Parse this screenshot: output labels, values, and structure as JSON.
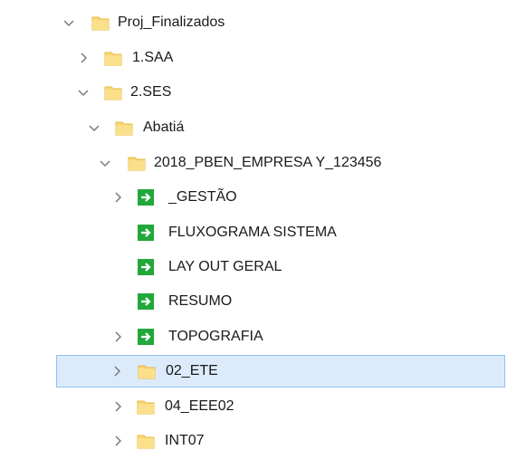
{
  "tree": {
    "items": [
      {
        "label": "Proj_Finalizados",
        "type": "folder",
        "expander": "expanded"
      },
      {
        "label": "1.SAA",
        "type": "folder",
        "expander": "collapsed"
      },
      {
        "label": "2.SES",
        "type": "folder",
        "expander": "expanded"
      },
      {
        "label": "Abatiá",
        "type": "folder",
        "expander": "expanded"
      },
      {
        "label": "2018_PBEN_EMPRESA Y_123456",
        "type": "folder",
        "expander": "expanded"
      },
      {
        "label": "_GESTÃO",
        "type": "shortcut",
        "expander": "collapsed"
      },
      {
        "label": "FLUXOGRAMA SISTEMA",
        "type": "shortcut",
        "expander": "none"
      },
      {
        "label": "LAY OUT GERAL",
        "type": "shortcut",
        "expander": "none"
      },
      {
        "label": "RESUMO",
        "type": "shortcut",
        "expander": "none"
      },
      {
        "label": "TOPOGRAFIA",
        "type": "shortcut",
        "expander": "collapsed"
      },
      {
        "label": "02_ETE",
        "type": "folder",
        "expander": "collapsed",
        "selected": true
      },
      {
        "label": "04_EEE02",
        "type": "folder",
        "expander": "collapsed"
      },
      {
        "label": "INT07",
        "type": "folder",
        "expander": "collapsed"
      }
    ]
  },
  "colors": {
    "folder": "#f8d775",
    "folder_dark": "#e8b940",
    "shortcut": "#22a83a",
    "selection_bg": "#dcebfc",
    "selection_border": "#90c0f4",
    "chevron": "#7a7a7a"
  },
  "icons": {
    "folder": "folder-icon",
    "shortcut": "shortcut-arrow-icon",
    "expanded": "chevron-down-icon",
    "collapsed": "chevron-right-icon"
  }
}
